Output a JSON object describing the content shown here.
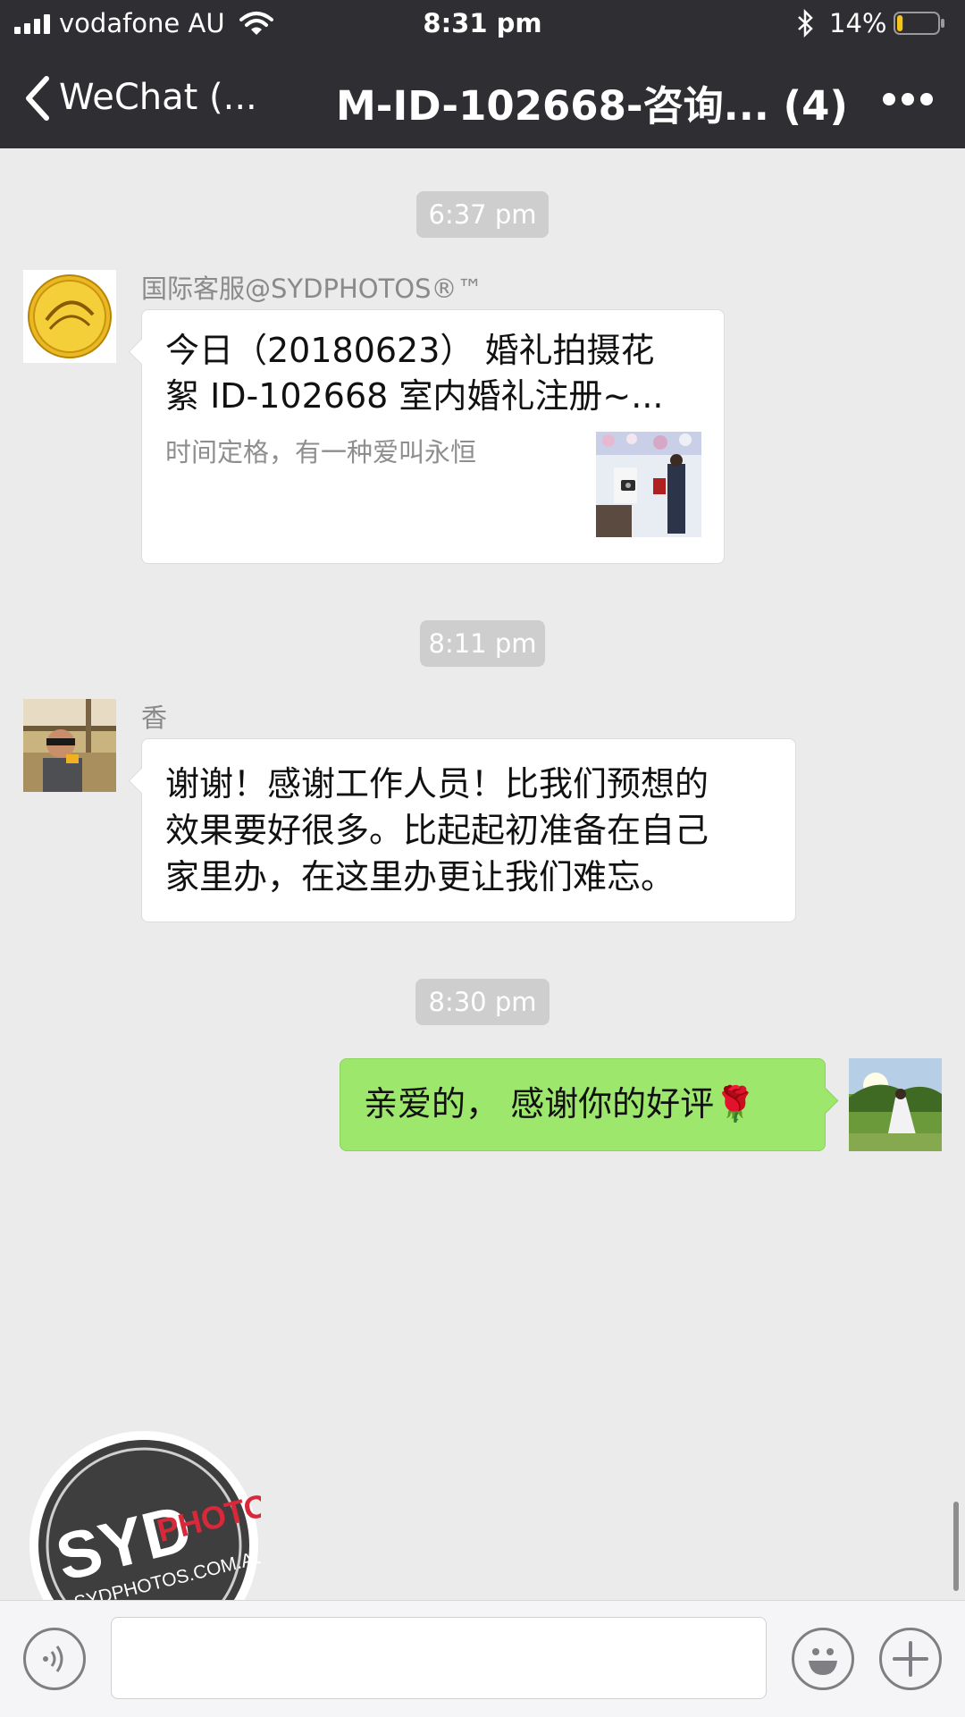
{
  "status_bar": {
    "carrier": "vodafone AU",
    "time": "8:31 pm",
    "battery_percent": "14%",
    "battery_level": 0.14,
    "icons": [
      "signal-icon",
      "wifi-icon",
      "bluetooth-icon",
      "battery-icon"
    ]
  },
  "nav": {
    "back_label": "WeChat (...",
    "title": "M-ID-102668-咨询... (4)",
    "more_icon": "more-icon"
  },
  "messages": [
    {
      "timestamp": "6:37 pm",
      "sender": "国际客服@SYDPHOTOS®™",
      "type": "link",
      "title": "今日（20180623） 婚礼拍摄花\n絮 ID-102668  室内婚礼注册~...",
      "description": "时间定格，有一种爱叫永恒"
    },
    {
      "timestamp": "8:11 pm",
      "sender": "香",
      "type": "text",
      "text": "谢谢！感谢工作人员！比我们预想的\n效果要好很多。比起起初准备在自己\n家里办，在这里办更让我们难忘。"
    },
    {
      "timestamp": "8:30 pm",
      "sender": "",
      "type": "text",
      "text": "亲爱的， 感谢你的好评🌹"
    }
  ],
  "input_bar": {
    "placeholder": "",
    "voice_icon": "voice-icon",
    "emoji_icon": "emoji-icon",
    "add_icon": "plus-icon"
  },
  "watermark": {
    "brand_syd": "SYD",
    "brand_photos": "PHOTOS",
    "url": "SYDPHOTOS.COM.AU"
  },
  "colors": {
    "nav_bg": "#2f2f33",
    "chat_bg": "#ebebeb",
    "outgoing_bubble": "#9de76c",
    "incoming_bubble": "#ffffff",
    "timestamp_bg": "#cecece",
    "battery_low": "#f5c518",
    "watermark_red": "#d8283a"
  }
}
